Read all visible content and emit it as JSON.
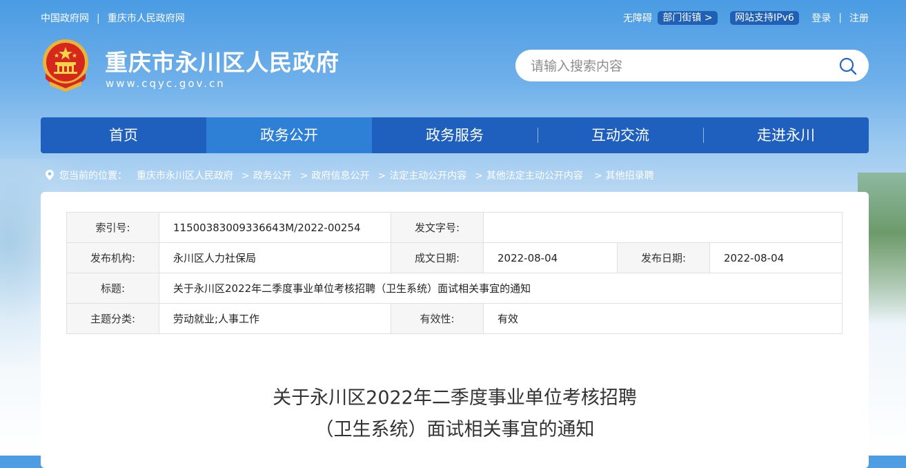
{
  "topbar": {
    "links": [
      "中国政府网",
      "重庆市人民政府网"
    ],
    "accessibility_label": "无障碍",
    "dept_pill": "部门街镇 >",
    "ipv6_pill": "网站支持IPv6",
    "login": "登录",
    "register": "注册"
  },
  "header": {
    "site_title": "重庆市永川区人民政府",
    "site_url": "www.cqyc.gov.cn",
    "search_placeholder": "请输入搜索内容"
  },
  "nav": {
    "items": [
      "首页",
      "政务公开",
      "政务服务",
      "互动交流",
      "走进永川"
    ],
    "active_index": 1
  },
  "breadcrumb": {
    "label": "您当前的位置：",
    "items": [
      "重庆市永川区人民政府",
      "政务公开",
      "政府信息公开",
      "法定主动公开内容",
      "其他法定主动公开内容",
      "其他招录聘"
    ]
  },
  "meta": {
    "index_label": "索引号:",
    "index_value": "11500383009336643M/2022-00254",
    "docno_label": "发文字号:",
    "docno_value": "",
    "org_label": "发布机构:",
    "org_value": "永川区人力社保局",
    "created_label": "成文日期:",
    "created_value": "2022-08-04",
    "published_label": "发布日期:",
    "published_value": "2022-08-04",
    "title_label": "标题:",
    "title_value": "关于永川区2022年二季度事业单位考核招聘（卫生系统）面试相关事宜的通知",
    "topic_label": "主题分类:",
    "topic_value": "劳动就业;人事工作",
    "validity_label": "有效性:",
    "validity_value": "有效"
  },
  "article": {
    "title_line1": "关于永川区2022年二季度事业单位考核招聘",
    "title_line2": "（卫生系统）面试相关事宜的通知"
  },
  "colors": {
    "nav_bg": "#1f5fbd",
    "nav_active": "#2e7fd6",
    "pill_bg": "#1f5fb4"
  }
}
